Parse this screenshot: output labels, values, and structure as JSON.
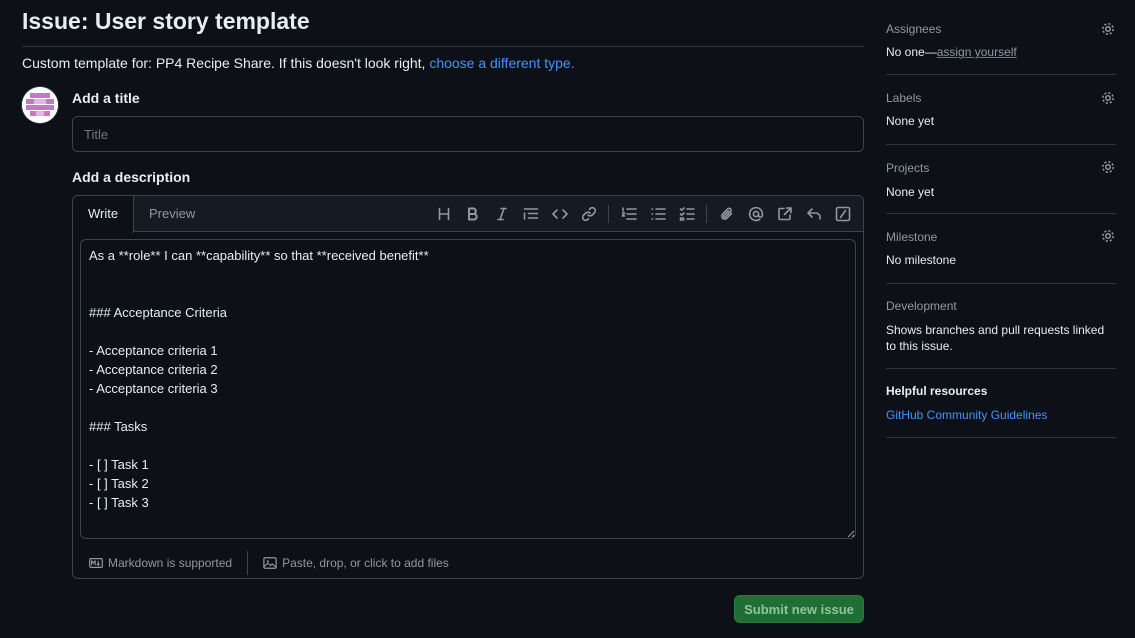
{
  "page": {
    "title": "Issue: User story template",
    "template_prefix": "Custom template for: PP4 Recipe Share. If this doesn't look right, ",
    "template_link": "choose a different type."
  },
  "form": {
    "title_label": "Add a title",
    "title_placeholder": "Title",
    "description_label": "Add a description",
    "tabs": [
      "Write",
      "Preview"
    ],
    "active_tab": "Write",
    "toolbar_icons": [
      "heading-icon",
      "bold-icon",
      "italic-icon",
      "quote-icon",
      "code-icon",
      "link-icon",
      "ordered-list-icon",
      "unordered-list-icon",
      "task-list-icon",
      "attach-icon",
      "mention-icon",
      "reference-icon",
      "reply-icon",
      "slash-commands-icon"
    ],
    "body_text": "As a **role** I can **capability** so that **received benefit**\n\n\n### Acceptance Criteria\n\n- Acceptance criteria 1\n- Acceptance criteria 2\n- Acceptance criteria 3\n\n### Tasks\n\n- [ ] Task 1\n- [ ] Task 2\n- [ ] Task 3",
    "markdown_note": "Markdown is supported",
    "attach_note": "Paste, drop, or click to add files",
    "submit_label": "Submit new issue"
  },
  "sidebar": {
    "assignees": {
      "heading": "Assignees",
      "value_prefix": "No one—",
      "value_link": "assign yourself"
    },
    "labels": {
      "heading": "Labels",
      "value": "None yet"
    },
    "projects": {
      "heading": "Projects",
      "value": "None yet"
    },
    "milestone": {
      "heading": "Milestone",
      "value": "No milestone"
    },
    "development": {
      "heading": "Development",
      "value": "Shows branches and pull requests linked to this issue."
    },
    "helpful": {
      "heading": "Helpful resources",
      "link": "GitHub Community Guidelines"
    }
  },
  "colors": {
    "background": "#0d1117",
    "border": "#30363d",
    "link": "#4493f8",
    "submit": "#1f6f35",
    "avatar_accent": "#c678c6"
  }
}
